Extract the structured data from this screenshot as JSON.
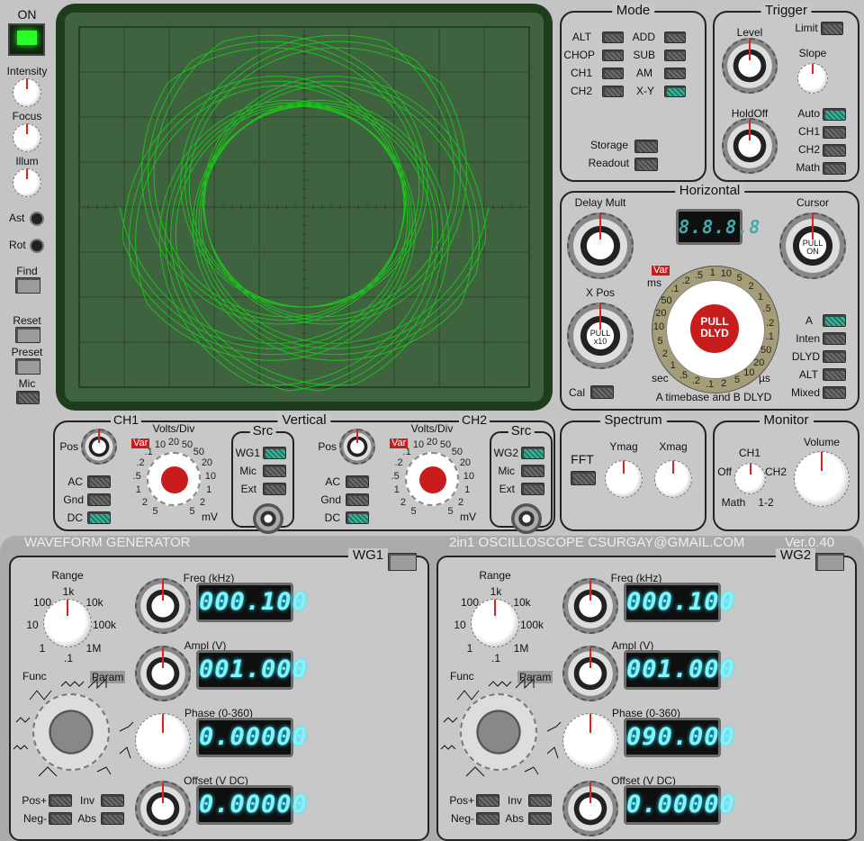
{
  "power": {
    "label": "ON"
  },
  "left": {
    "intensity": "Intensity",
    "focus": "Focus",
    "illum": "Illum",
    "ast": "Ast",
    "rot": "Rot",
    "find": "Find",
    "reset": "Reset",
    "preset": "Preset",
    "mic": "Mic"
  },
  "mode": {
    "title": "Mode",
    "alt": "ALT",
    "chop": "CHOP",
    "ch1": "CH1",
    "ch2": "CH2",
    "add": "ADD",
    "sub": "SUB",
    "am": "AM",
    "xy": "X-Y",
    "storage": "Storage",
    "readout": "Readout"
  },
  "trigger": {
    "title": "Trigger",
    "level": "Level",
    "limit": "Limit",
    "slope": "Slope",
    "holdoff": "HoldOff",
    "auto": "Auto",
    "ch1": "CH1",
    "ch2": "CH2",
    "math": "Math"
  },
  "horizontal": {
    "title": "Horizontal",
    "delay_mult": "Delay Mult",
    "display": "8.8.8.8",
    "cursor": "Cursor",
    "cursor_knob": "PULL ON",
    "xpos": "X Pos",
    "xpos_knob": "PULL x10",
    "var": "Var",
    "ms": "ms",
    "sec": "sec",
    "us": "µs",
    "cal": "Cal",
    "pull_dlyd": "PULL DLYD",
    "footer": "A timebase and B DLYD",
    "a": "A",
    "inten": "Inten",
    "dlyd": "DLYD",
    "alt": "ALT",
    "mixed": "Mixed",
    "dial_outer": [
      "1",
      ".5",
      ".2",
      ".1",
      "50",
      "20",
      "10",
      "5",
      "2",
      "1",
      ".5",
      ".2",
      ".1",
      "2",
      "5",
      "10",
      "20",
      "50",
      ".1",
      ".2",
      ".5",
      "1",
      "2",
      "5",
      "10"
    ]
  },
  "vertical": {
    "title": "Vertical",
    "ch1": "CH1",
    "ch2": "CH2",
    "pos": "Pos",
    "volts_div": "Volts/Div",
    "var": "Var",
    "ac": "AC",
    "gnd": "Gnd",
    "dc": "DC",
    "mv": "mV",
    "src": "Src",
    "wg1": "WG1",
    "wg2": "WG2",
    "mic": "Mic",
    "ext": "Ext",
    "dial": [
      "5",
      "2",
      "1",
      ".5",
      ".2",
      ".1",
      "10",
      "20",
      "50",
      "50",
      "20",
      "10",
      "1",
      "2",
      "5"
    ]
  },
  "spectrum": {
    "title": "Spectrum",
    "fft": "FFT",
    "ymag": "Ymag",
    "xmag": "Xmag"
  },
  "monitor": {
    "title": "Monitor",
    "ch1": "CH1",
    "off": "Off",
    "ch2": "CH2",
    "math": "Math",
    "one_two": "1-2",
    "volume": "Volume"
  },
  "bottom": {
    "left": "WAVEFORM GENERATOR",
    "right": "2in1 OSCILLOSCOPE   CSURGAY@GMAIL.COM",
    "version": "Ver.0.40"
  },
  "wg1": {
    "title": "WG1",
    "range": "Range",
    "range_labels": [
      "1k",
      "100",
      "10k",
      "10",
      "100k",
      "1",
      "1M",
      ".1"
    ],
    "func": "Func",
    "param": "Param",
    "freq_label": "Freq (kHz)",
    "freq": "000.100",
    "ampl_label": "Ampl (V)",
    "ampl": "001.000",
    "phase_label": "Phase (0-360)",
    "phase": "0.00000",
    "offset_label": "Offset (V DC)",
    "offset": "0.00000",
    "pos": "Pos+",
    "neg": "Neg-",
    "inv": "Inv",
    "abs": "Abs"
  },
  "wg2": {
    "title": "WG2",
    "range": "Range",
    "range_labels": [
      "1k",
      "100",
      "10k",
      "10",
      "100k",
      "1",
      "1M",
      ".1"
    ],
    "func": "Func",
    "param": "Param",
    "freq_label": "Freq (kHz)",
    "freq": "000.100",
    "ampl_label": "Ampl (V)",
    "ampl": "001.000",
    "phase_label": "Phase (0-360)",
    "phase": "090.000",
    "offset_label": "Offset (V DC)",
    "offset": "0.00000",
    "pos": "Pos+",
    "neg": "Neg-",
    "inv": "Inv",
    "abs": "Abs"
  },
  "colors": {
    "trace": "#18d018",
    "crt": "#3e633e",
    "accent": "#d21f1f",
    "switch_on": "#2d9b83"
  }
}
